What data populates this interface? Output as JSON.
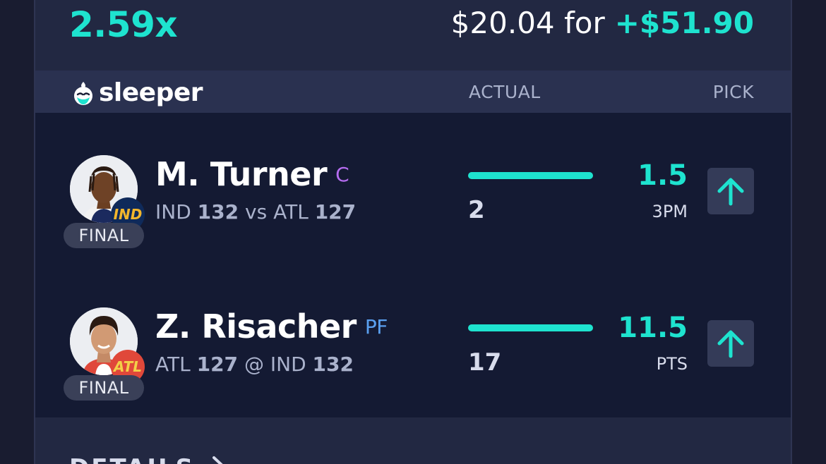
{
  "summary": {
    "multiplier": "2.59x",
    "stake_text": "$20.04 for",
    "win_text": "+$51.90"
  },
  "header": {
    "brand": "sleeper",
    "actual_label": "ACTUAL",
    "pick_label": "PICK"
  },
  "colors": {
    "accent": "#1ee3cf",
    "background": "#191c30",
    "card": "#222842",
    "rows_bg": "#141a33",
    "pos_c": "#b56cf0",
    "pos_pf": "#5aa0f0",
    "ind_badge": "#0f2a5a",
    "atl_badge": "#e0483a"
  },
  "players": [
    {
      "name": "M. Turner",
      "position": "C",
      "team": "IND",
      "team_score": "132",
      "separator": "vs",
      "opponent": "ATL",
      "opponent_score": "127",
      "status": "FINAL",
      "actual": "2",
      "line": "1.5",
      "stat": "3PM",
      "progress": 1.0,
      "pick_direction": "up",
      "pick_icon": "arrow-up-icon"
    },
    {
      "name": "Z. Risacher",
      "position": "PF",
      "team": "ATL",
      "team_score": "127",
      "separator": "@",
      "opponent": "IND",
      "opponent_score": "132",
      "status": "FINAL",
      "actual": "17",
      "line": "11.5",
      "stat": "PTS",
      "progress": 1.0,
      "pick_direction": "up",
      "pick_icon": "arrow-up-icon"
    }
  ],
  "footer": {
    "details_label": "DETAILS",
    "details_icon": "chevron-right-icon"
  }
}
